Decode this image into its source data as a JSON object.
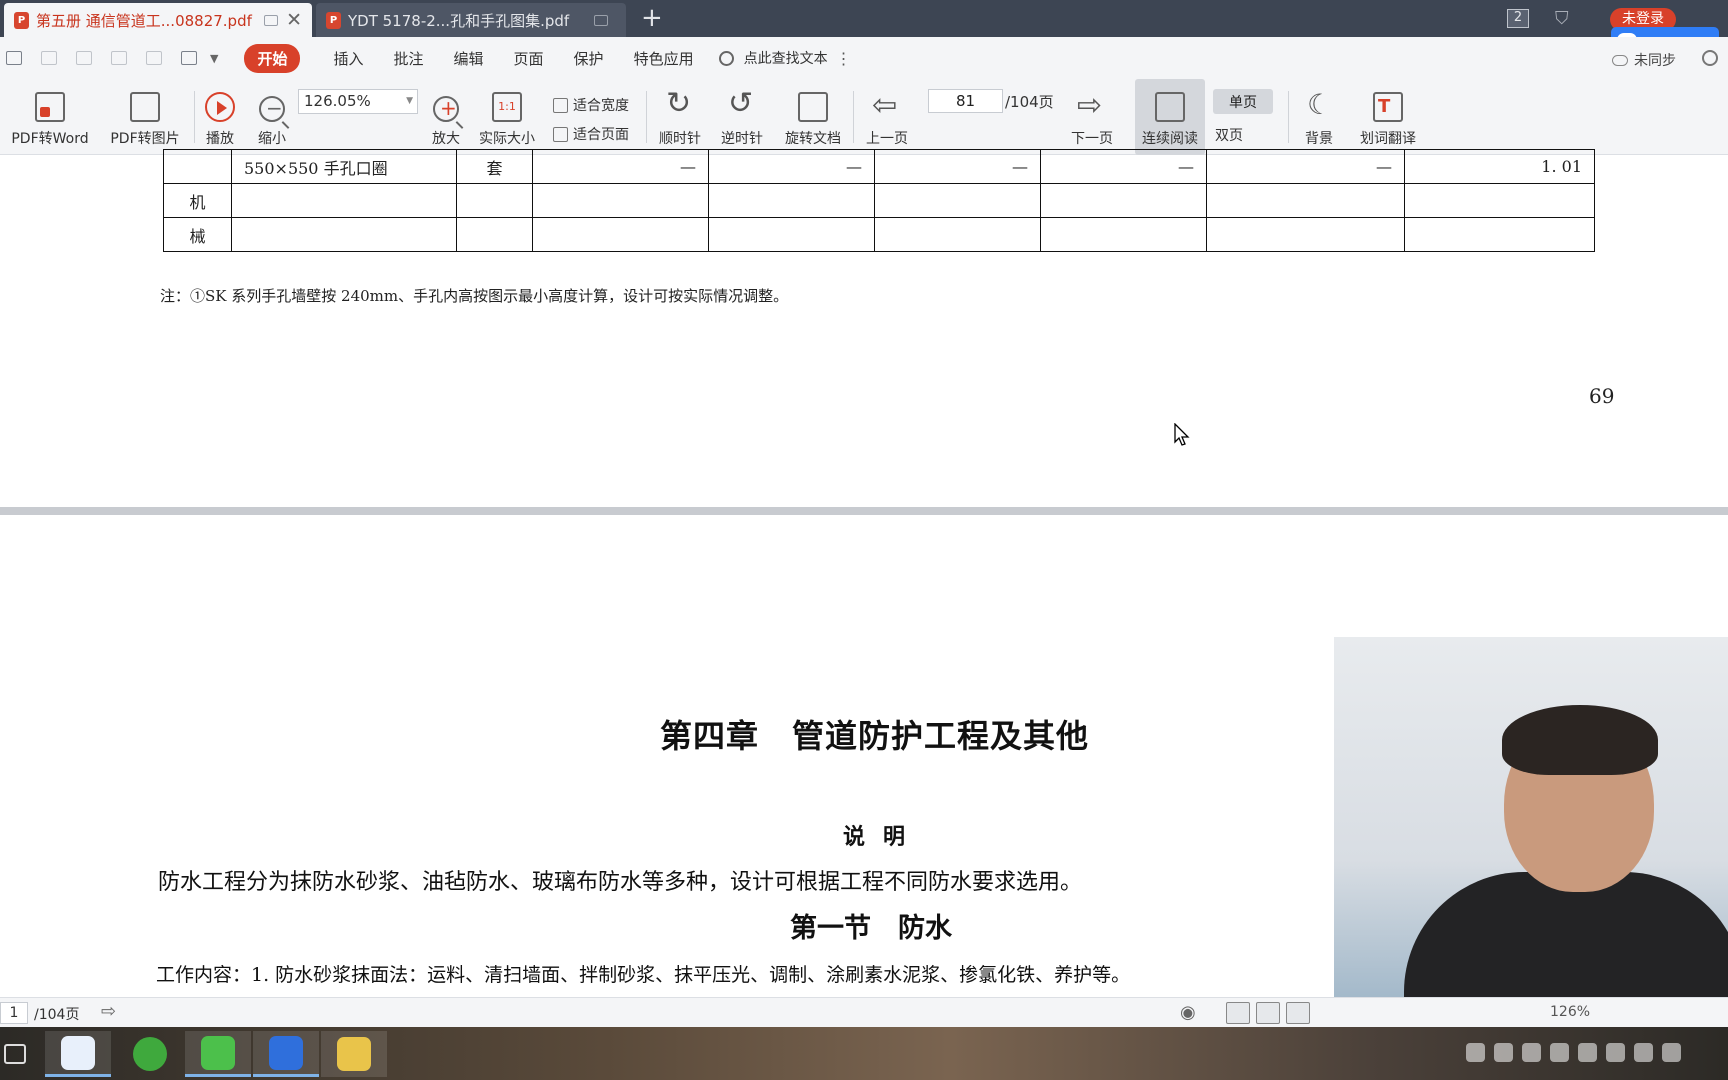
{
  "tabs": [
    {
      "title": "第五册 通信管道工...08827.pdf",
      "active": true
    },
    {
      "title": "YDT 5178-2...孔和手孔图集.pdf",
      "active": false
    }
  ],
  "tab_count": "2",
  "login_label": "未登录",
  "menu": [
    "开始",
    "插入",
    "批注",
    "编辑",
    "页面",
    "保护",
    "特色应用"
  ],
  "search_hint": "点此查找文本",
  "sync_label": "未同步",
  "toolbar": {
    "pdf_to_word": "PDF转Word",
    "pdf_to_image": "PDF转图片",
    "play": "播放",
    "zoom_out": "缩小",
    "zoom_value": "126.05%",
    "zoom_in": "放大",
    "actual_size": "实际大小",
    "fit_width": "适合宽度",
    "fit_page": "适合页面",
    "clockwise": "顺时针",
    "counterclockwise": "逆时针",
    "rotate_doc": "旋转文档",
    "prev_page": "上一页",
    "page_number": "81",
    "page_total": "/104页",
    "next_page": "下一页",
    "continuous": "连续阅读",
    "single_page": "单页",
    "double_page": "双页",
    "background": "背景",
    "translate": "划词翻译"
  },
  "table_fragment": {
    "row_item": "550×550 手孔口圈",
    "row_unit": "套",
    "row_values": [
      "—",
      "—",
      "—",
      "—",
      "—",
      "1. 01"
    ],
    "machine_label_1": "机",
    "machine_label_2": "械"
  },
  "note_text": "注：①SK 系列手孔墙壁按 240mm、手孔内高按图示最小高度计算，设计可按实际情况调整。",
  "page_number_label": "69",
  "chapter_title": "第四章　管道防护工程及其他",
  "explain_heading": "说明",
  "explain_paragraph": "防水工程分为抹防水砂浆、油毡防水、玻璃布防水等多种，设计可根据工程不同防水要求选用。",
  "section_title": "第一节　防水",
  "work_content": "工作内容：1. 防水砂浆抹面法：运料、清扫墙面、拌制砂浆、抹平压光、调制、涂刷素水泥浆、掺氯化铁、养护等。",
  "status": {
    "page": "1",
    "total": "/104页",
    "zoom": "126%"
  },
  "colors": {
    "accent": "#d8412a",
    "tab_bar": "#3d4553",
    "toolbar_bg": "#f4f5f7"
  }
}
